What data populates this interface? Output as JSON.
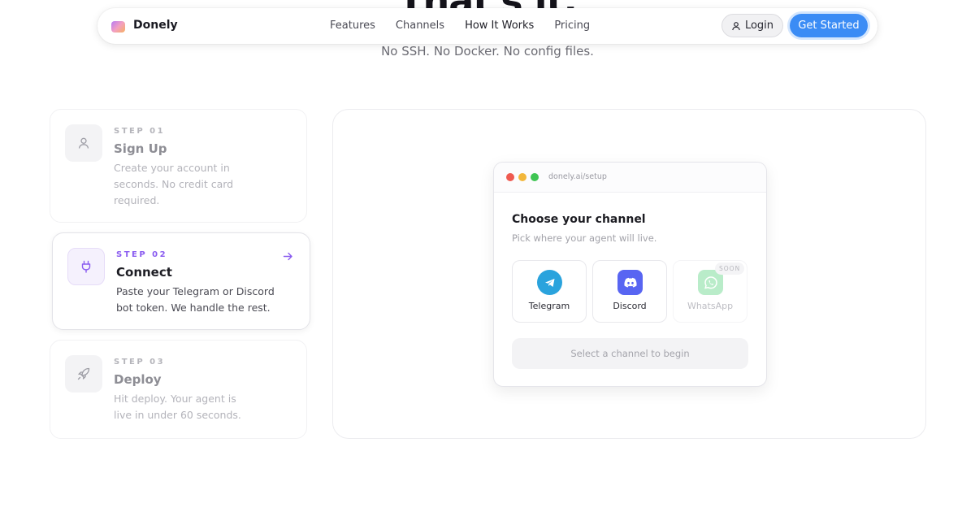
{
  "hero": {
    "title": "That's it.",
    "subtitle": "No SSH. No Docker. No config files."
  },
  "nav": {
    "brand": "Donely",
    "links": [
      {
        "label": "Features"
      },
      {
        "label": "Channels"
      },
      {
        "label": "How It Works",
        "active": true
      },
      {
        "label": "Pricing"
      }
    ],
    "login_label": "Login",
    "cta_label": "Get Started",
    "accent_color": "#3b8cf5"
  },
  "steps": [
    {
      "kicker": "STEP 01",
      "title": "Sign Up",
      "description": "Create your account in seconds. No credit card required.",
      "icon": "user-icon"
    },
    {
      "kicker": "STEP 02",
      "title": "Connect",
      "description": "Paste your Telegram or Discord bot token. We handle the rest.",
      "icon": "plug-icon",
      "active": true
    },
    {
      "kicker": "STEP 03",
      "title": "Deploy",
      "description": "Hit deploy. Your agent is live in under 60 seconds.",
      "icon": "rocket-icon"
    }
  ],
  "preview": {
    "url": "donely.ai/setup",
    "title": "Choose your channel",
    "subtitle": "Pick where your agent will live.",
    "channels": [
      {
        "label": "Telegram",
        "icon": "telegram-icon",
        "color": "#2aa3dd"
      },
      {
        "label": "Discord",
        "icon": "discord-icon",
        "color": "#5865f2"
      },
      {
        "label": "WhatsApp",
        "icon": "whatsapp-icon",
        "color": "#b9ecc9",
        "badge": "SOON"
      }
    ],
    "action_label": "Select a channel to begin"
  }
}
